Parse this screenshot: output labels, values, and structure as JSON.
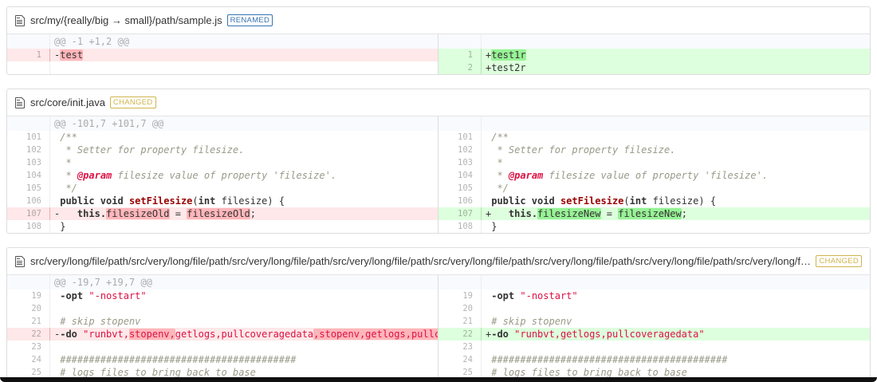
{
  "app": "side-by-side-diff-viewer",
  "colors": {
    "del_line_bg": "#fee8e9",
    "ins_line_bg": "#ddffdd",
    "del_word_bg": "#ffb6ba",
    "ins_word_bg": "#97f295",
    "hunk_info_bg": "#f8fafd",
    "renamed_accent": "#3572b0",
    "changed_accent": "#d0b44c",
    "keyword_color": "#333333",
    "string_color": "#dd1144",
    "comment_color": "#999988",
    "function_name_color": "#990000"
  },
  "files": [
    {
      "name": "src/my/{really/big → small}/path/sample.js",
      "tag": "RENAMED",
      "tag_type": "renamed",
      "hunk": "@@ -1 +1,2 @@",
      "rows": [
        {
          "left": {
            "ln": "1",
            "type": "del",
            "segs": [
              [
                "-",
                ""
              ],
              [
                "test",
                "m"
              ]
            ]
          },
          "right": {
            "ln": "1",
            "type": "ins",
            "segs": [
              [
                "+",
                ""
              ],
              [
                "test1r",
                "m"
              ]
            ]
          }
        },
        {
          "left": {
            "ln": "",
            "type": "empty",
            "segs": []
          },
          "right": {
            "ln": "2",
            "type": "ins",
            "segs": [
              [
                "+",
                ""
              ],
              [
                "test2r",
                ""
              ]
            ]
          }
        }
      ]
    },
    {
      "name": "src/core/init.java",
      "tag": "CHANGED",
      "tag_type": "changed",
      "hunk": "@@ -101,7 +101,7 @@",
      "rows": [
        {
          "left": {
            "ln": "101",
            "type": "cx",
            "segs": [
              [
                " ",
                ""
              ],
              [
                "/**",
                "c"
              ]
            ]
          },
          "right": {
            "ln": "101",
            "type": "cx",
            "segs": [
              [
                " ",
                ""
              ],
              [
                "/**",
                "c"
              ]
            ]
          }
        },
        {
          "left": {
            "ln": "102",
            "type": "cx",
            "segs": [
              [
                " ",
                ""
              ],
              [
                " * Setter for property filesize.",
                "c"
              ]
            ]
          },
          "right": {
            "ln": "102",
            "type": "cx",
            "segs": [
              [
                " ",
                ""
              ],
              [
                " * Setter for property filesize.",
                "c"
              ]
            ]
          }
        },
        {
          "left": {
            "ln": "103",
            "type": "cx",
            "segs": [
              [
                " ",
                ""
              ],
              [
                " *",
                "c"
              ]
            ]
          },
          "right": {
            "ln": "103",
            "type": "cx",
            "segs": [
              [
                " ",
                ""
              ],
              [
                " *",
                "c"
              ]
            ]
          }
        },
        {
          "left": {
            "ln": "104",
            "type": "cx",
            "segs": [
              [
                " ",
                ""
              ],
              [
                " * ",
                "c"
              ],
              [
                "@param",
                "d"
              ],
              [
                " filesize value of property 'filesize'.",
                "c"
              ]
            ]
          },
          "right": {
            "ln": "104",
            "type": "cx",
            "segs": [
              [
                " ",
                ""
              ],
              [
                " * ",
                "c"
              ],
              [
                "@param",
                "d"
              ],
              [
                " filesize value of property 'filesize'.",
                "c"
              ]
            ]
          }
        },
        {
          "left": {
            "ln": "105",
            "type": "cx",
            "segs": [
              [
                " ",
                ""
              ],
              [
                " */",
                "c"
              ]
            ]
          },
          "right": {
            "ln": "105",
            "type": "cx",
            "segs": [
              [
                " ",
                ""
              ],
              [
                " */",
                "c"
              ]
            ]
          }
        },
        {
          "left": {
            "ln": "106",
            "type": "cx",
            "segs": [
              [
                " ",
                ""
              ],
              [
                "public void ",
                "k"
              ],
              [
                "setFilesize",
                "t"
              ],
              [
                "(",
                ""
              ],
              [
                "int",
                "k"
              ],
              [
                " filesize) {",
                ""
              ]
            ]
          },
          "right": {
            "ln": "106",
            "type": "cx",
            "segs": [
              [
                " ",
                ""
              ],
              [
                "public void ",
                "k"
              ],
              [
                "setFilesize",
                "t"
              ],
              [
                "(",
                ""
              ],
              [
                "int",
                "k"
              ],
              [
                " filesize) {",
                ""
              ]
            ]
          }
        },
        {
          "left": {
            "ln": "107",
            "type": "del",
            "segs": [
              [
                "-",
                ""
              ],
              [
                "   ",
                ""
              ],
              [
                "this.",
                "k"
              ],
              [
                "filesizeOld",
                "m"
              ],
              [
                " = ",
                ""
              ],
              [
                "filesizeOld",
                "m"
              ],
              [
                ";",
                ""
              ]
            ]
          },
          "right": {
            "ln": "107",
            "type": "ins",
            "segs": [
              [
                "+",
                ""
              ],
              [
                "   ",
                ""
              ],
              [
                "this.",
                "k"
              ],
              [
                "filesizeNew",
                "m"
              ],
              [
                " = ",
                ""
              ],
              [
                "filesizeNew",
                "m"
              ],
              [
                ";",
                ""
              ]
            ]
          }
        },
        {
          "left": {
            "ln": "108",
            "type": "cx",
            "segs": [
              [
                " ",
                ""
              ],
              [
                "}",
                ""
              ]
            ]
          },
          "right": {
            "ln": "108",
            "type": "cx",
            "segs": [
              [
                " ",
                ""
              ],
              [
                "}",
                ""
              ]
            ]
          }
        }
      ]
    },
    {
      "name": "src/very/long/file/path/src/very/long/file/path/src/very/long/file/path/src/very/long/file/path/src/very/long/file/path/src/very/long/file/path/src/very/long/file/path/src/very/long/file/path/src/very/long/file/path",
      "tag": "CHANGED",
      "tag_type": "changed",
      "hunk": "@@ -19,7 +19,7 @@",
      "rows": [
        {
          "left": {
            "ln": "19",
            "type": "cx",
            "segs": [
              [
                " ",
                ""
              ],
              [
                "-opt",
                "k"
              ],
              [
                " ",
                ""
              ],
              [
                "\"-nostart\"",
                "s"
              ]
            ]
          },
          "right": {
            "ln": "19",
            "type": "cx",
            "segs": [
              [
                " ",
                ""
              ],
              [
                "-opt",
                "k"
              ],
              [
                " ",
                ""
              ],
              [
                "\"-nostart\"",
                "s"
              ]
            ]
          }
        },
        {
          "left": {
            "ln": "20",
            "type": "cx",
            "segs": [
              [
                " ",
                ""
              ]
            ]
          },
          "right": {
            "ln": "20",
            "type": "cx",
            "segs": [
              [
                " ",
                ""
              ]
            ]
          }
        },
        {
          "left": {
            "ln": "21",
            "type": "cx",
            "segs": [
              [
                " ",
                ""
              ],
              [
                "# skip stopenv",
                "c"
              ]
            ]
          },
          "right": {
            "ln": "21",
            "type": "cx",
            "segs": [
              [
                " ",
                ""
              ],
              [
                "# skip stopenv",
                "c"
              ]
            ]
          }
        },
        {
          "left": {
            "ln": "22",
            "type": "del",
            "segs": [
              [
                "-",
                ""
              ],
              [
                "-do",
                "k"
              ],
              [
                " ",
                ""
              ],
              [
                "\"runbvt,",
                "s"
              ],
              [
                "stopenv,",
                "m s"
              ],
              [
                "getlogs,pullcoveragedata",
                "s"
              ],
              [
                ",stopenv,getlogs,pullcoveragedata",
                "m s"
              ],
              [
                "\"",
                "s"
              ]
            ]
          },
          "right": {
            "ln": "22",
            "type": "ins",
            "segs": [
              [
                "+",
                ""
              ],
              [
                "-do",
                "k"
              ],
              [
                " ",
                ""
              ],
              [
                "\"runbvt,getlogs,pullcoveragedata\"",
                "s"
              ]
            ]
          }
        },
        {
          "left": {
            "ln": "23",
            "type": "cx",
            "segs": [
              [
                " ",
                ""
              ]
            ]
          },
          "right": {
            "ln": "23",
            "type": "cx",
            "segs": [
              [
                " ",
                ""
              ]
            ]
          }
        },
        {
          "left": {
            "ln": "24",
            "type": "cx",
            "segs": [
              [
                " ",
                ""
              ],
              [
                "#########################################",
                "c"
              ]
            ]
          },
          "right": {
            "ln": "24",
            "type": "cx",
            "segs": [
              [
                " ",
                ""
              ],
              [
                "#########################################",
                "c"
              ]
            ]
          }
        },
        {
          "left": {
            "ln": "25",
            "type": "cx",
            "segs": [
              [
                " ",
                ""
              ],
              [
                "# logs files to bring back to base",
                "c"
              ]
            ]
          },
          "right": {
            "ln": "25",
            "type": "cx",
            "segs": [
              [
                " ",
                ""
              ],
              [
                "# logs files to bring back to base",
                "c"
              ]
            ]
          }
        }
      ]
    }
  ]
}
